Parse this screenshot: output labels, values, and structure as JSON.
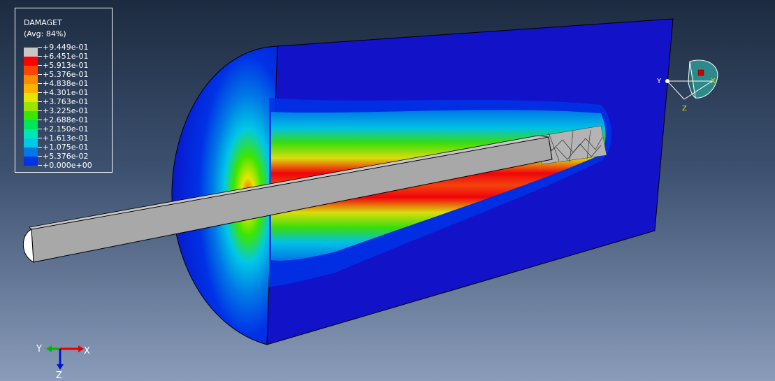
{
  "legend": {
    "title": "DAMAGET",
    "avg": "(Avg: 84%)",
    "entries": [
      {
        "value": "+9.449e-01",
        "color": "#c8c8c8"
      },
      {
        "value": "+6.451e-01",
        "color": "#ff0000"
      },
      {
        "value": "+5.913e-01",
        "color": "#ff4500"
      },
      {
        "value": "+5.376e-01",
        "color": "#ff8c00"
      },
      {
        "value": "+4.838e-01",
        "color": "#ffb300"
      },
      {
        "value": "+4.301e-01",
        "color": "#e6e600"
      },
      {
        "value": "+3.763e-01",
        "color": "#9be600"
      },
      {
        "value": "+3.225e-01",
        "color": "#3ce600"
      },
      {
        "value": "+2.688e-01",
        "color": "#00e65a"
      },
      {
        "value": "+2.150e-01",
        "color": "#00e6b4"
      },
      {
        "value": "+1.613e-01",
        "color": "#00c8e6"
      },
      {
        "value": "+1.075e-01",
        "color": "#0078e6"
      },
      {
        "value": "+5.376e-02",
        "color": "#0032e6"
      },
      {
        "value": "+0.000e+00",
        "color": null
      }
    ]
  },
  "triad": {
    "y": "Y",
    "x": "X",
    "z": "Z"
  },
  "view_cube": {
    "y": "Y",
    "x": "X",
    "z": "Z"
  }
}
